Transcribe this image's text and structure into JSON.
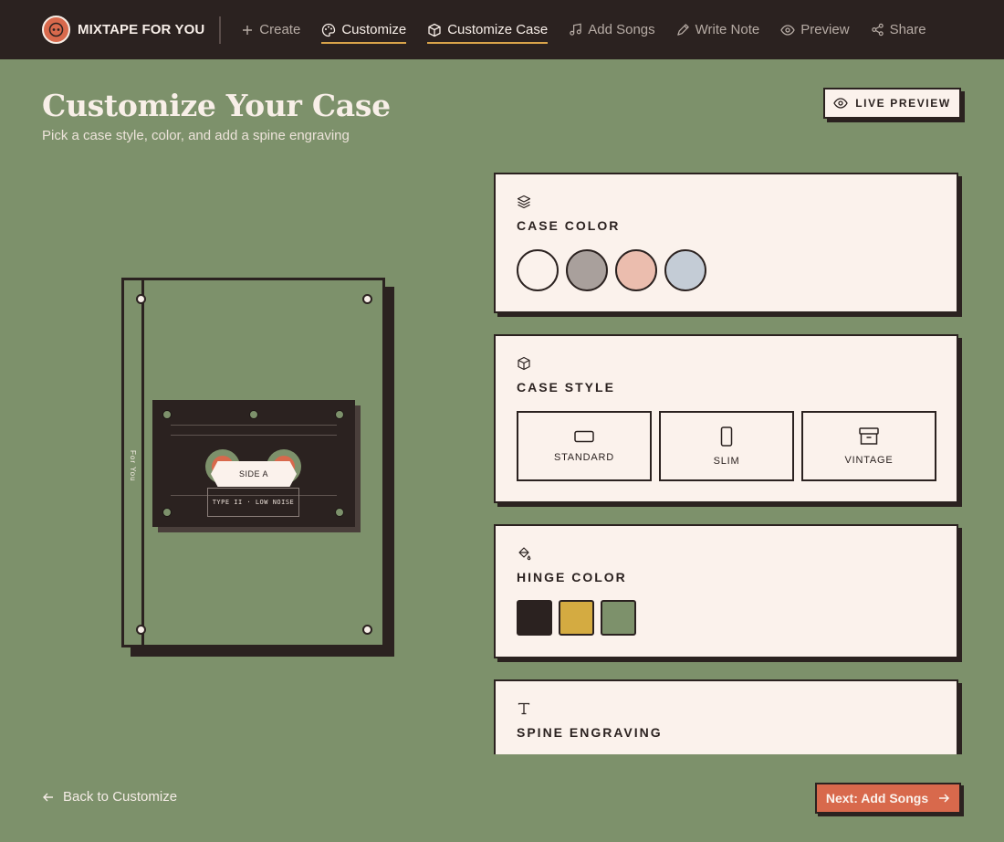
{
  "brand": {
    "name": "MIXTAPE FOR YOU"
  },
  "nav": {
    "items": [
      {
        "label": "Create",
        "icon": "plus-icon"
      },
      {
        "label": "Customize",
        "icon": "palette-icon"
      },
      {
        "label": "Customize Case",
        "icon": "box-icon"
      },
      {
        "label": "Add Songs",
        "icon": "music-note-icon"
      },
      {
        "label": "Write Note",
        "icon": "pen-icon"
      },
      {
        "label": "Preview",
        "icon": "eye-icon"
      },
      {
        "label": "Share",
        "icon": "share-icon"
      }
    ]
  },
  "header": {
    "title": "Customize Your Case",
    "subtitle": "Pick a case style, color, and add a spine engraving",
    "live_preview": "LIVE PREVIEW"
  },
  "preview": {
    "spine_text": "For You",
    "tape_label": "SIDE A",
    "tape_type": "TYPE II · LOW NOISE"
  },
  "case_color": {
    "title": "CASE COLOR",
    "swatches": [
      "#fbf2ec",
      "#a9a09c",
      "#ebbdae",
      "#c4ccd6"
    ]
  },
  "case_style": {
    "title": "CASE STYLE",
    "options": [
      "STANDARD",
      "SLIM",
      "VINTAGE"
    ]
  },
  "hinge_color": {
    "title": "HINGE COLOR",
    "swatches": [
      "#2b2220",
      "#d4ab41",
      "#7d916b"
    ]
  },
  "spine_engraving": {
    "title": "SPINE ENGRAVING"
  },
  "footer": {
    "back_label": "Back to Customize",
    "next_label": "Next: Add Songs"
  }
}
